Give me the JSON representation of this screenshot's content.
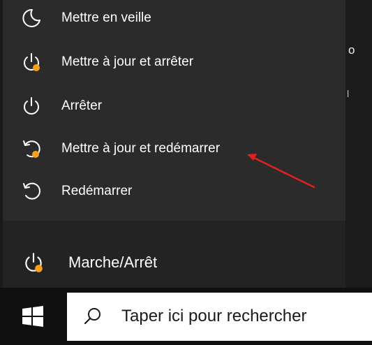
{
  "power_menu": {
    "items": [
      {
        "label": "Mettre en veille",
        "icon": "moon-icon"
      },
      {
        "label": "Mettre à jour et arrêter",
        "icon": "update-and-shutdown-icon"
      },
      {
        "label": "Arrêter",
        "icon": "power-icon"
      },
      {
        "label": "Mettre à jour et redémarrer",
        "icon": "update-and-restart-icon"
      },
      {
        "label": "Redémarrer",
        "icon": "restart-icon"
      }
    ]
  },
  "start_menu": {
    "power_button_label": "Marche/Arrêt",
    "power_button_icon": "power-update-icon"
  },
  "background": {
    "partial_text_1": "o",
    "partial_text_2": "l"
  },
  "taskbar": {
    "start_icon": "windows-logo-icon",
    "search_placeholder": "Taper ici pour rechercher",
    "search_icon": "search-icon"
  },
  "colors": {
    "menu_bg": "#2b2b2b",
    "update_badge": "#f7a01c",
    "annotation_arrow": "#e0211f",
    "taskbar_bg": "#101010"
  }
}
